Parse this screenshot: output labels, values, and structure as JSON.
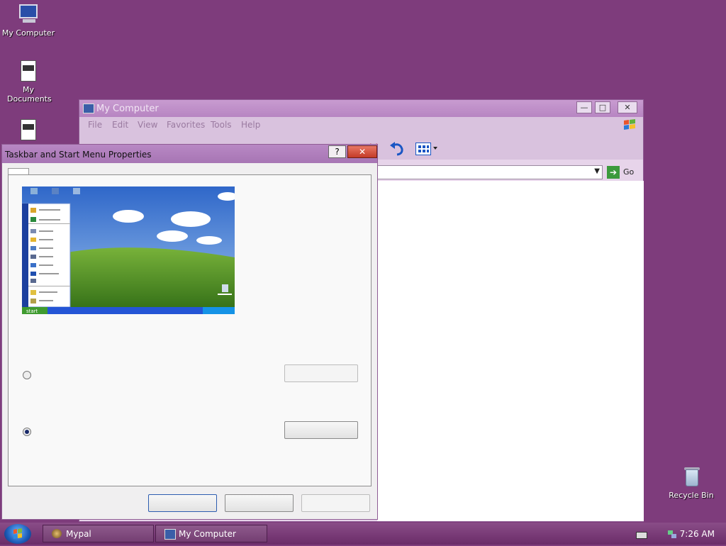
{
  "desktop": {
    "icons": [
      {
        "label": "My Computer",
        "icon": "computer-icon"
      },
      {
        "label": "My Documents",
        "icon": "documents-icon"
      },
      {
        "label": "",
        "icon": "document-icon"
      },
      {
        "label": "Recycle Bin",
        "icon": "recycle-bin-icon"
      }
    ]
  },
  "my_computer_window": {
    "title": "My Computer",
    "menu": [
      "File",
      "Edit",
      "View",
      "Favorites",
      "Tools",
      "Help"
    ],
    "go_label": "Go",
    "controls": {
      "minimize": "—",
      "maximize": "□",
      "close": "✕"
    }
  },
  "dialog": {
    "title": "Taskbar and Start Menu Properties",
    "help": "?",
    "close": "✕",
    "preview": {
      "start_label": "start",
      "recycle_label": "Recycle Bin"
    },
    "options": [
      {
        "name": "option-1",
        "selected": false
      },
      {
        "name": "option-2",
        "selected": true
      }
    ]
  },
  "taskbar": {
    "items": [
      {
        "label": "Mypal",
        "icon": "mypal-icon"
      },
      {
        "label": "My Computer",
        "icon": "computer-icon"
      }
    ],
    "clock": "7:26 AM"
  }
}
